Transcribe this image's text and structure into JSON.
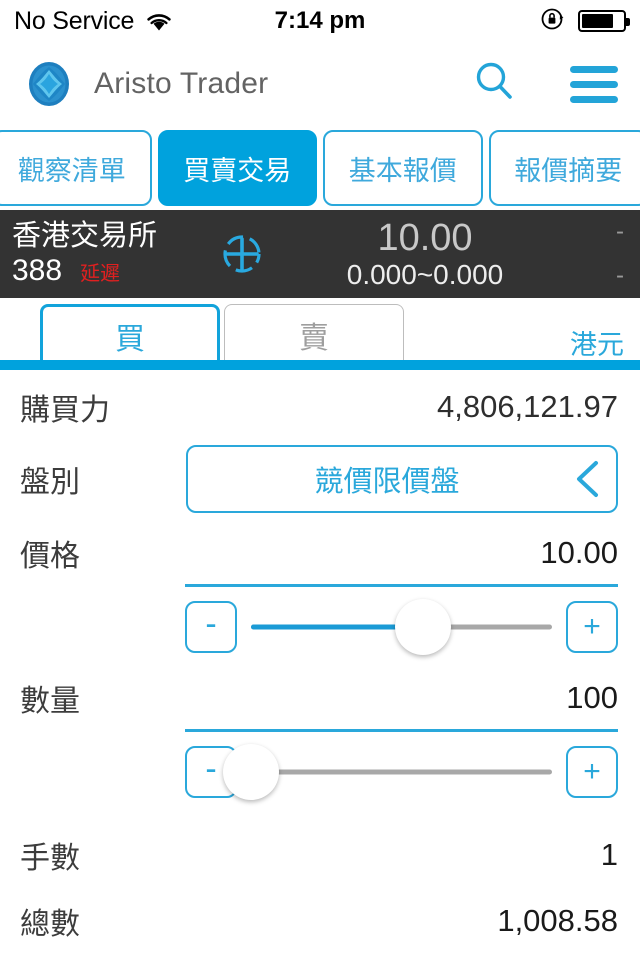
{
  "status_bar": {
    "carrier": "No Service",
    "wifi_icon": "wifi-icon",
    "time": "7:14 pm",
    "rotation_lock_icon": "rotation-lock-icon",
    "battery_icon": "battery-icon",
    "battery_level_percent": 70
  },
  "app_bar": {
    "logo_icon": "app-logo-icon",
    "title": "Aristo Trader",
    "search_icon": "search-icon",
    "menu_icon": "hamburger-menu-icon"
  },
  "main_tabs": [
    {
      "label": "觀察清單",
      "active": false
    },
    {
      "label": "買賣交易",
      "active": true
    },
    {
      "label": "基本報價",
      "active": false
    },
    {
      "label": "報價摘要",
      "active": false
    }
  ],
  "quote": {
    "exchange_name": "香港交易所",
    "code": "388",
    "delay_badge": "延遲",
    "target_icon": "crosshair-target-icon",
    "price": "10.00",
    "range": "0.000~0.000",
    "right_top": "-",
    "right_bottom": "-"
  },
  "side_tabs": {
    "buy_label": "買",
    "sell_label": "賣",
    "active": "buy",
    "currency": "港元"
  },
  "order_form": {
    "buying_power_label": "購買力",
    "buying_power_value": "4,806,121.97",
    "order_type_label": "盤別",
    "order_type_value": "競價限價盤",
    "order_type_chevron_icon": "chevron-left-icon",
    "price_label": "價格",
    "price_value": "10.00",
    "price_minus_label": "-",
    "price_plus_label": "+",
    "price_slider_percent": 57,
    "quantity_label": "數量",
    "quantity_value": "100",
    "quantity_minus_label": "-",
    "quantity_plus_label": "+",
    "quantity_slider_percent": 0,
    "lots_label": "手數",
    "lots_value": "1",
    "total_label": "總數",
    "total_value": "1,008.58"
  },
  "colors": {
    "accent_blue": "#00A2DD",
    "outline_blue": "#2AA8DB",
    "quote_bar_bg": "#333333",
    "delay_red": "#E02020"
  }
}
